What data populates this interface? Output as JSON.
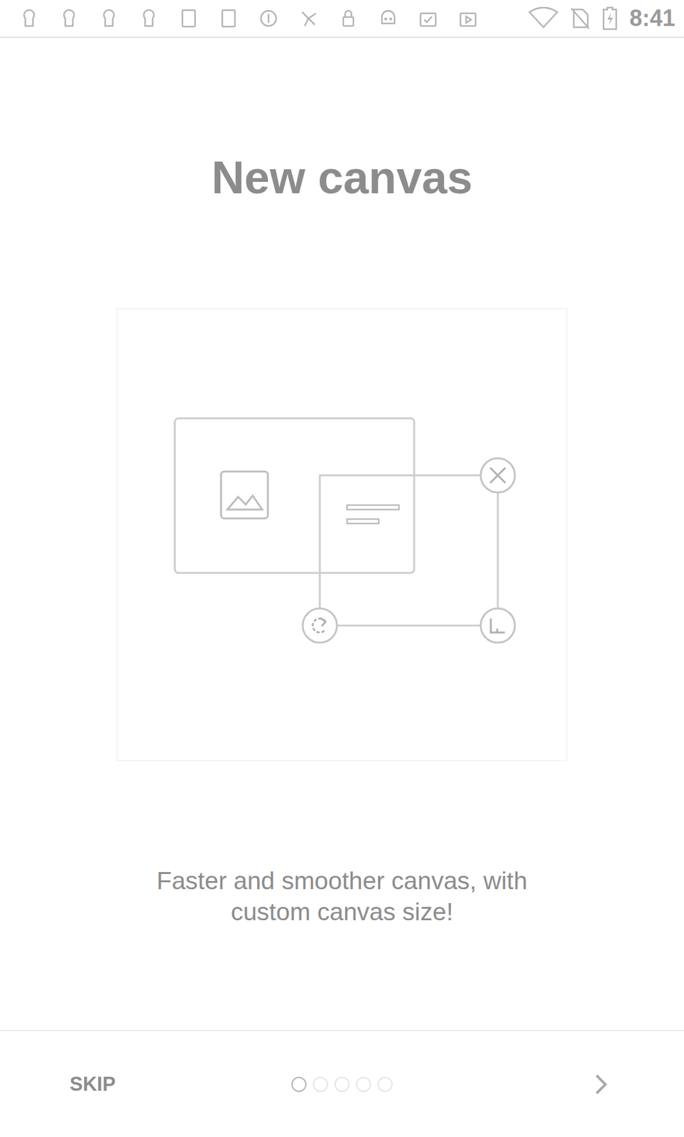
{
  "status_bar": {
    "time": "8:41"
  },
  "page": {
    "title": "New canvas",
    "description": "Faster and smoother canvas, with custom canvas size!"
  },
  "pager": {
    "dots": [
      {
        "selected": true
      },
      {
        "selected": false
      },
      {
        "selected": false
      },
      {
        "selected": false
      },
      {
        "selected": false
      }
    ]
  },
  "buttons": {
    "skip": "SKIP"
  }
}
